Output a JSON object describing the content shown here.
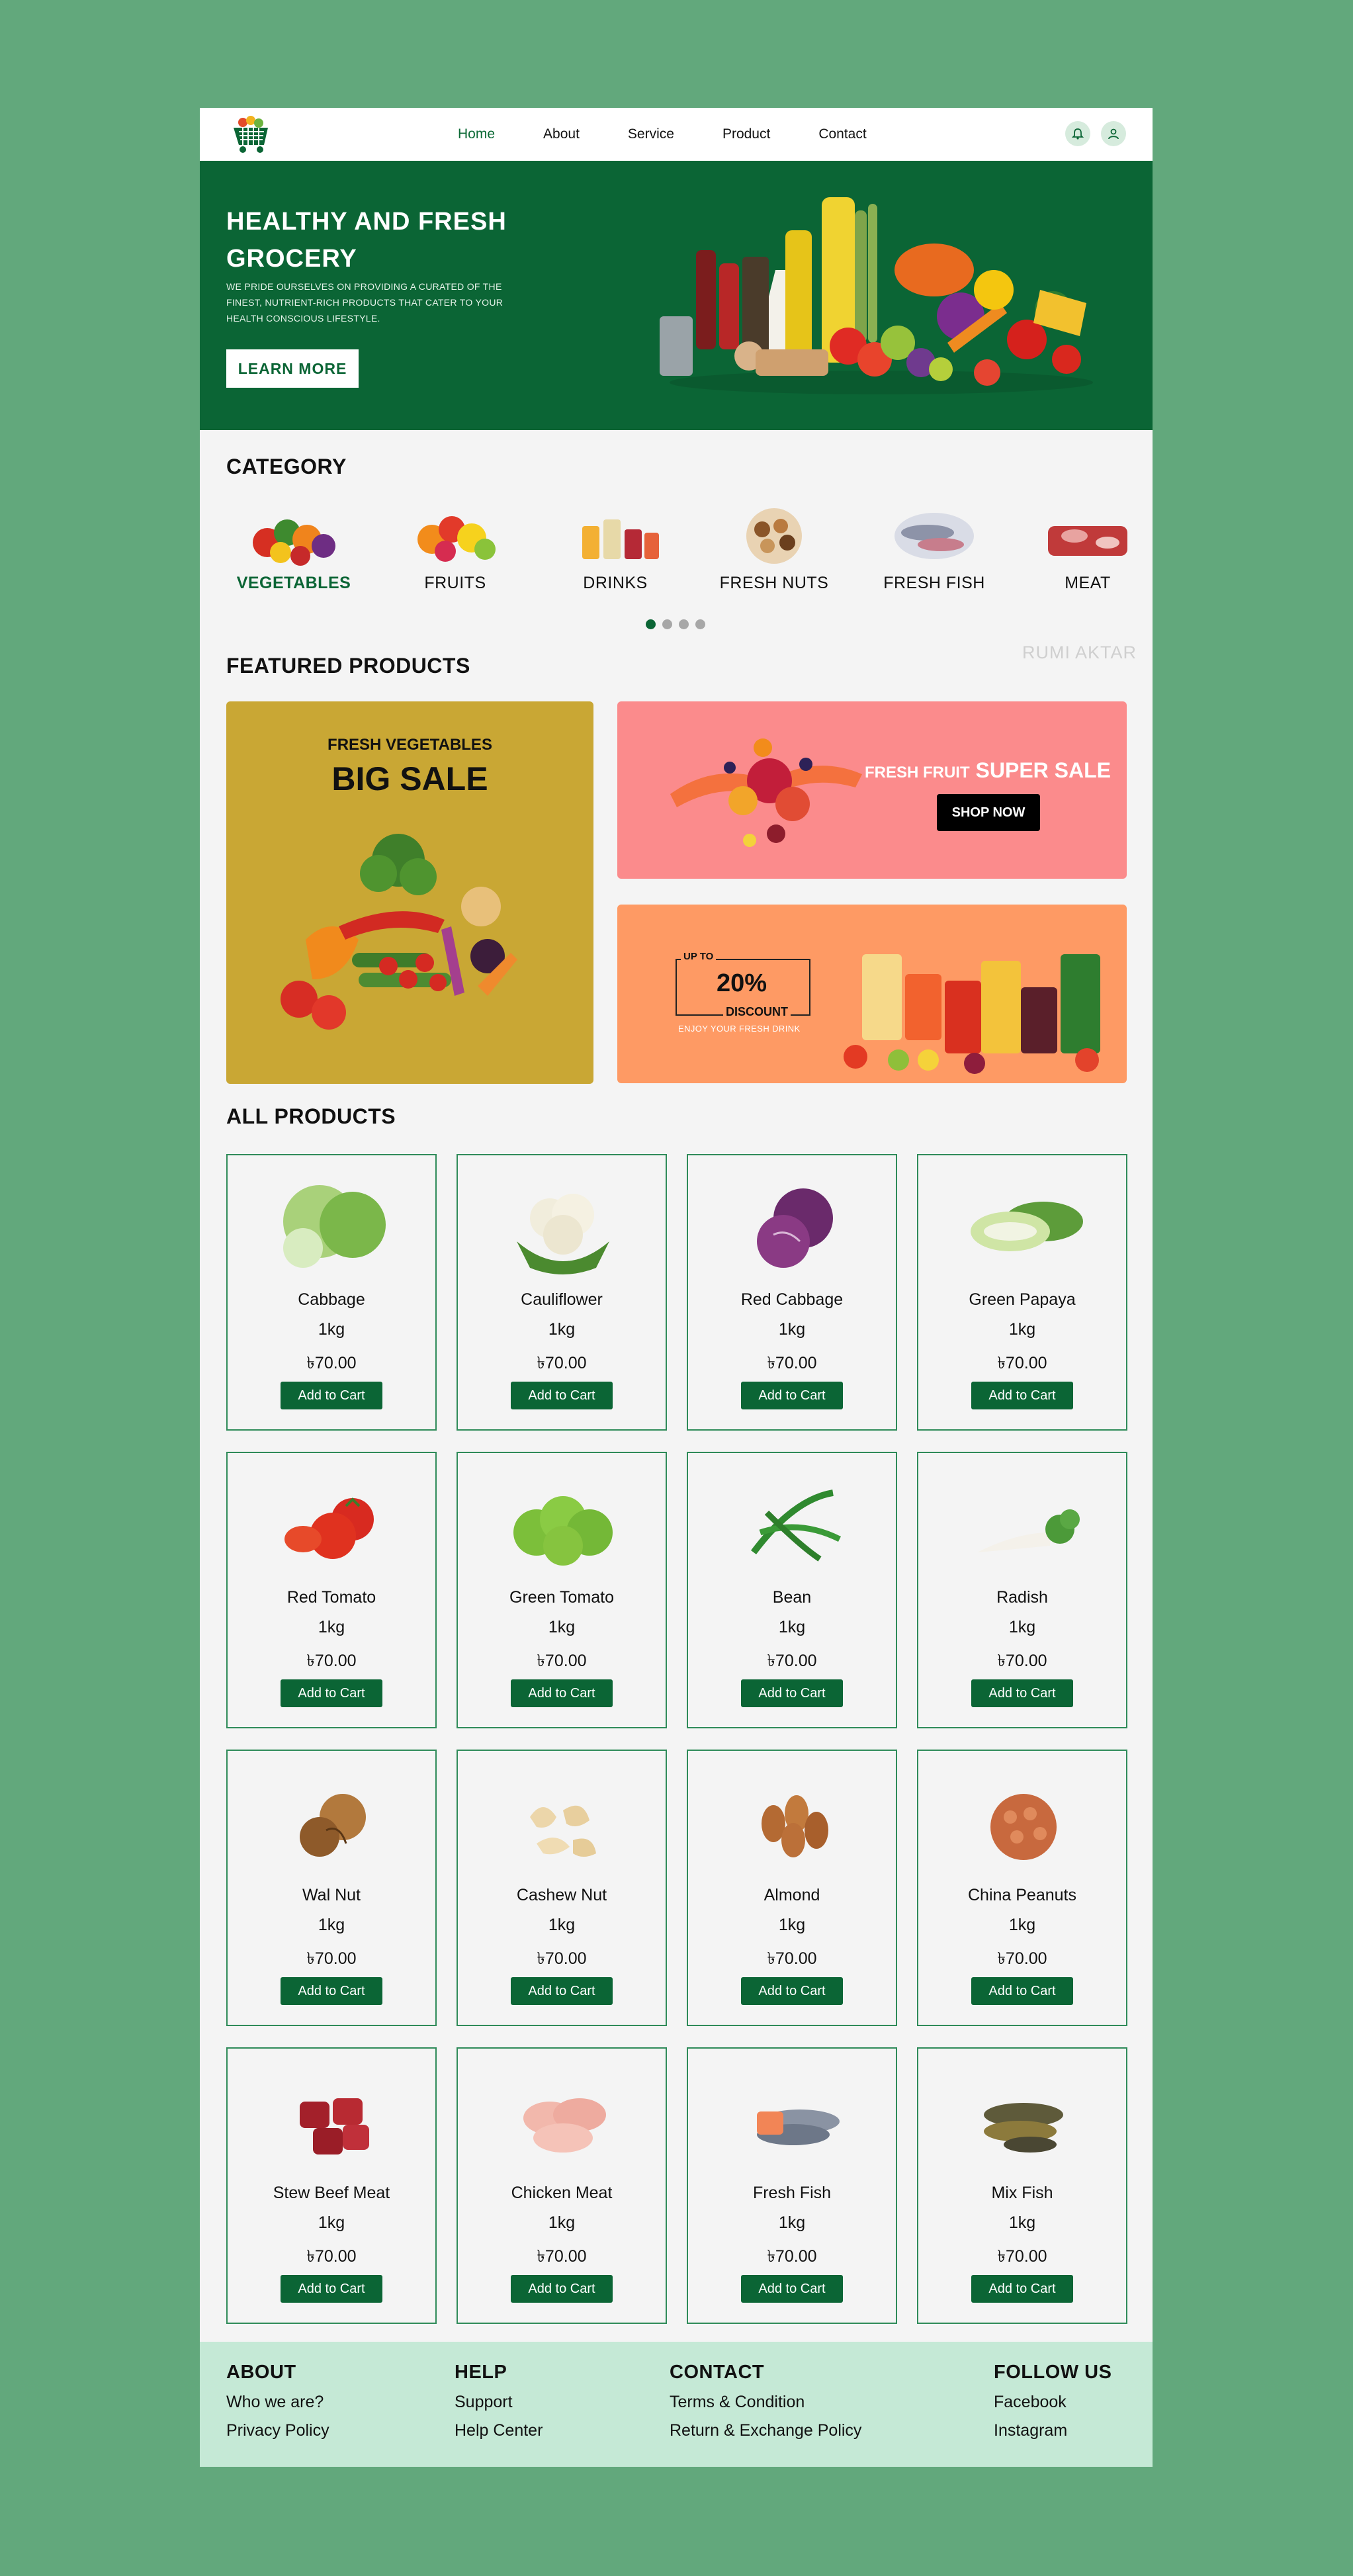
{
  "nav": {
    "items": [
      "Home",
      "About",
      "Service",
      "Product",
      "Contact"
    ],
    "active": "Home",
    "icons": [
      "bell-icon",
      "user-icon"
    ]
  },
  "hero": {
    "title": "HEALTHY AND FRESH GROCERY",
    "subtitle": "WE PRIDE OURSELVES ON PROVIDING A CURATED OF THE FINEST, NUTRIENT-RICH PRODUCTS THAT CATER TO YOUR HEALTH CONSCIOUS LIFESTYLE.",
    "button": "LEARN MORE"
  },
  "category": {
    "title": "CATEGORY",
    "items": [
      "VEGETABLES",
      "FRUITS",
      "DRINKS",
      "FRESH NUTS",
      "FRESH FISH",
      "MEAT"
    ],
    "active_index": 0,
    "carousel_pages": 4,
    "carousel_active": 0
  },
  "watermark": "RUMI AKTAR",
  "featured": {
    "title": "FEATURED PRODUCTS",
    "big": {
      "small": "FRESH VEGETABLES",
      "large": "BIG SALE"
    },
    "pink": {
      "small": "FRESH FRUIT",
      "large": "SUPER SALE",
      "button": "SHOP NOW"
    },
    "orange": {
      "up_to": "UP TO",
      "percent": "20%",
      "discount": "DISCOUNT",
      "sub": "ENJOY YOUR FRESH DRINK"
    }
  },
  "products": {
    "title": "ALL PRODUCTS",
    "button": "Add to Cart",
    "items": [
      {
        "name": "Cabbage",
        "weight": "1kg",
        "price": "৳70.00"
      },
      {
        "name": "Cauliflower",
        "weight": "1kg",
        "price": "৳70.00"
      },
      {
        "name": "Red Cabbage",
        "weight": "1kg",
        "price": "৳70.00"
      },
      {
        "name": "Green Papaya",
        "weight": "1kg",
        "price": "৳70.00"
      },
      {
        "name": "Red Tomato",
        "weight": "1kg",
        "price": "৳70.00"
      },
      {
        "name": "Green Tomato",
        "weight": "1kg",
        "price": "৳70.00"
      },
      {
        "name": "Bean",
        "weight": "1kg",
        "price": "৳70.00"
      },
      {
        "name": "Radish",
        "weight": "1kg",
        "price": "৳70.00"
      },
      {
        "name": "Wal Nut",
        "weight": "1kg",
        "price": "৳70.00"
      },
      {
        "name": "Cashew Nut",
        "weight": "1kg",
        "price": "৳70.00"
      },
      {
        "name": "Almond",
        "weight": "1kg",
        "price": "৳70.00"
      },
      {
        "name": "China Peanuts",
        "weight": "1kg",
        "price": "৳70.00"
      },
      {
        "name": "Stew Beef Meat",
        "weight": "1kg",
        "price": "৳70.00"
      },
      {
        "name": "Chicken Meat",
        "weight": "1kg",
        "price": "৳70.00"
      },
      {
        "name": "Fresh Fish",
        "weight": "1kg",
        "price": "৳70.00"
      },
      {
        "name": "Mix Fish",
        "weight": "1kg",
        "price": "৳70.00"
      }
    ]
  },
  "footer": {
    "about": {
      "title": "ABOUT",
      "links": [
        "Who we are?",
        "Privacy Policy"
      ]
    },
    "help": {
      "title": "HELP",
      "links": [
        "Support",
        "Help Center"
      ]
    },
    "contact": {
      "title": "CONTACT",
      "links": [
        "Terms & Condition",
        "Return & Exchange Policy"
      ]
    },
    "follow": {
      "title": "FOLLOW US",
      "links": [
        "Facebook",
        "Instagram"
      ]
    }
  },
  "colors": {
    "brand_green": "#0b6535",
    "backdrop": "#62a87c",
    "footer_bg": "#c5e9d6",
    "gold_banner": "#c9a734",
    "pink_banner": "#fb8b8c",
    "orange_banner": "#fe9a64"
  }
}
